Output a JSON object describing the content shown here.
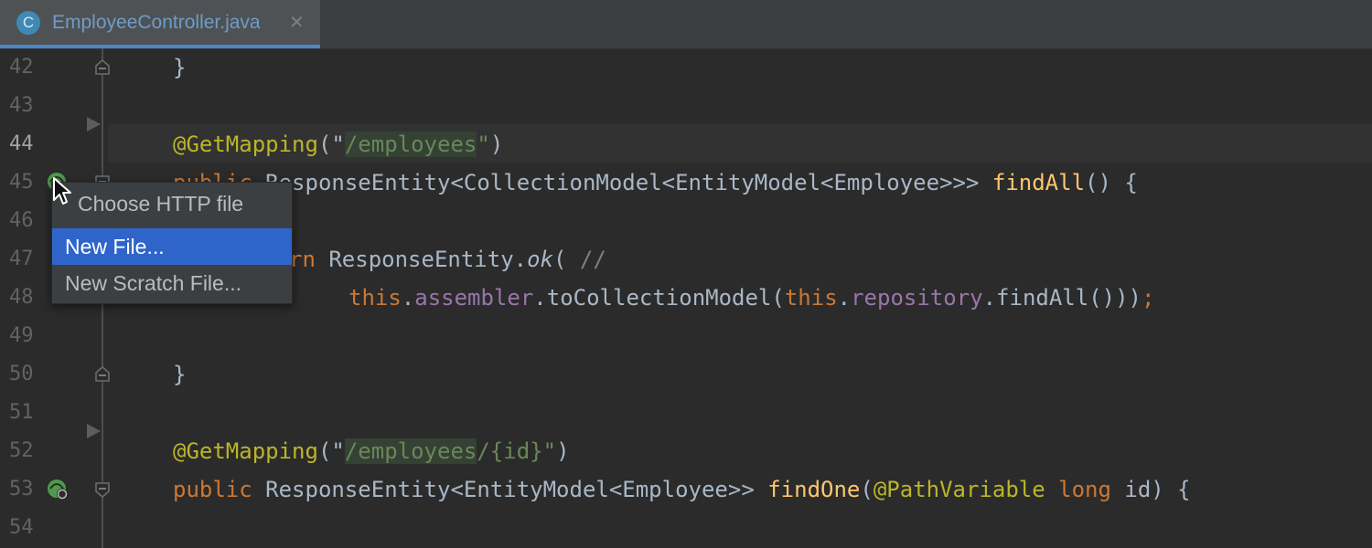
{
  "tab": {
    "icon_letter": "C",
    "filename": "EmployeeController.java",
    "close_glyph": "✕"
  },
  "lines": [
    {
      "num": "42"
    },
    {
      "num": "43"
    },
    {
      "num": "44"
    },
    {
      "num": "45"
    },
    {
      "num": "46"
    },
    {
      "num": "47"
    },
    {
      "num": "48"
    },
    {
      "num": "49"
    },
    {
      "num": "50"
    },
    {
      "num": "51"
    },
    {
      "num": "52"
    },
    {
      "num": "53"
    },
    {
      "num": "54"
    }
  ],
  "code": {
    "l42": {
      "brace": "}"
    },
    "l44": {
      "annotation": "@GetMapping",
      "open": "(\"",
      "path": "/employees",
      "close_q": "\"",
      "close": ")"
    },
    "l45": {
      "public": "public",
      "type": "ResponseEntity<CollectionModel<EntityModel<Employee>>>",
      "method": "findAll",
      "tail": "() {"
    },
    "l47": {
      "kw_tail": "rn",
      "cls": "ResponseEntity.",
      "ok": "ok",
      "paren": "( ",
      "comment": "//"
    },
    "l48": {
      "this1": "this",
      "dot1": ".",
      "field1": "assembler",
      "mid": ".toCollectionModel(",
      "this2": "this",
      "dot2": ".",
      "field2": "repository",
      "end": ".findAll()))",
      "semi": ";"
    },
    "l50": {
      "brace": "}"
    },
    "l52": {
      "annotation": "@GetMapping",
      "open": "(\"",
      "path1": "/employees",
      "path2": "/{id}",
      "close_q": "\"",
      "close": ")"
    },
    "l53": {
      "public": "public",
      "type": "ResponseEntity<EntityModel<Employee>> ",
      "method": "findOne",
      "paren": "(",
      "ann": "@PathVariable",
      "long": "long",
      "tail": " id) {"
    }
  },
  "popup": {
    "title": "Choose HTTP file",
    "items": [
      "New File...",
      "New Scratch File..."
    ],
    "selected": "New File..."
  },
  "colors": {
    "editor_bg": "#2b2b2b",
    "keyword": "#cc7832",
    "annotation": "#bbb529",
    "string": "#6a8759",
    "method": "#ffc66d",
    "field": "#9876aa",
    "text": "#a9b7c6",
    "selection": "#2f65ca"
  },
  "icons": {
    "endpoint": "web-endpoint-icon",
    "fold": "fold-marker-icon",
    "arrow": "fold-arrow-icon"
  }
}
